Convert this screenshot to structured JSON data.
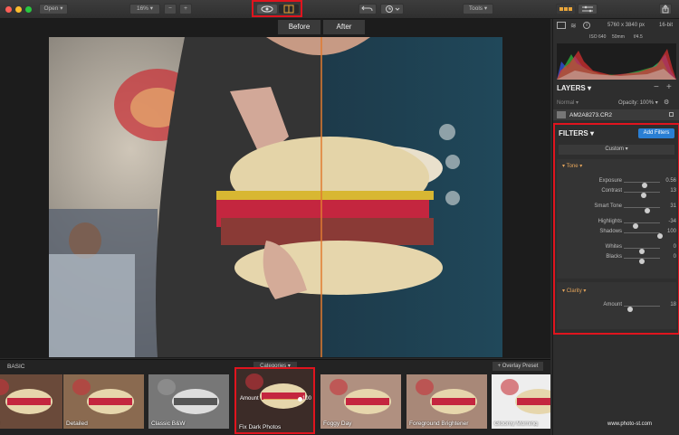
{
  "toolbar": {
    "open_label": "Open",
    "zoom_value": "16%",
    "zoom_out": "−",
    "zoom_in": "+",
    "tools_label": "Tools"
  },
  "compare": {
    "before": "Before",
    "after": "After"
  },
  "image_info": {
    "dimensions": "5760 x 3840 px",
    "bit_depth": "16-bit",
    "iso": "ISO 640",
    "focal": "50mm",
    "aperture": "f/4.5"
  },
  "layers": {
    "title": "LAYERS",
    "blend_mode": "Normal",
    "opacity_label": "Opacity:",
    "opacity_value": "100%",
    "layer_name": "AM2A8273.CR2"
  },
  "filters": {
    "title": "FILTERS",
    "add_button": "Add Filters",
    "preset_select": "Custom",
    "tone": {
      "title": "Tone",
      "sliders": [
        {
          "label": "Exposure",
          "value": "0.56",
          "pos": 0.58
        },
        {
          "label": "Contrast",
          "value": "13",
          "pos": 0.56
        },
        {
          "label": "Smart Tone",
          "value": "31",
          "pos": 0.65
        },
        {
          "label": "Highlights",
          "value": "-34",
          "pos": 0.33
        },
        {
          "label": "Shadows",
          "value": "100",
          "pos": 1.0
        },
        {
          "label": "Whites",
          "value": "0",
          "pos": 0.5
        },
        {
          "label": "Blacks",
          "value": "0",
          "pos": 0.5
        }
      ]
    },
    "clarity": {
      "title": "Clarity",
      "sliders": [
        {
          "label": "Amount",
          "value": "18",
          "pos": 0.18
        }
      ]
    }
  },
  "strip": {
    "section_label": "BASIC",
    "categories_label": "Categories",
    "overlay_label": "+ Overlay Preset",
    "amount_label": "Amount",
    "amount_value": "100",
    "presets": [
      "ancer",
      "Detailed",
      "Classic B&W",
      "Fix Dark Photos",
      "Foggy Day",
      "Foreground Brightener",
      "Gloomy Morning"
    ]
  },
  "watermark": "www.photo-st.com",
  "colors": {
    "accent": "#2a7fd4",
    "highlight_box": "#e0141e",
    "tone_label": "#e2a35a",
    "compare_line": "#e07b30"
  }
}
